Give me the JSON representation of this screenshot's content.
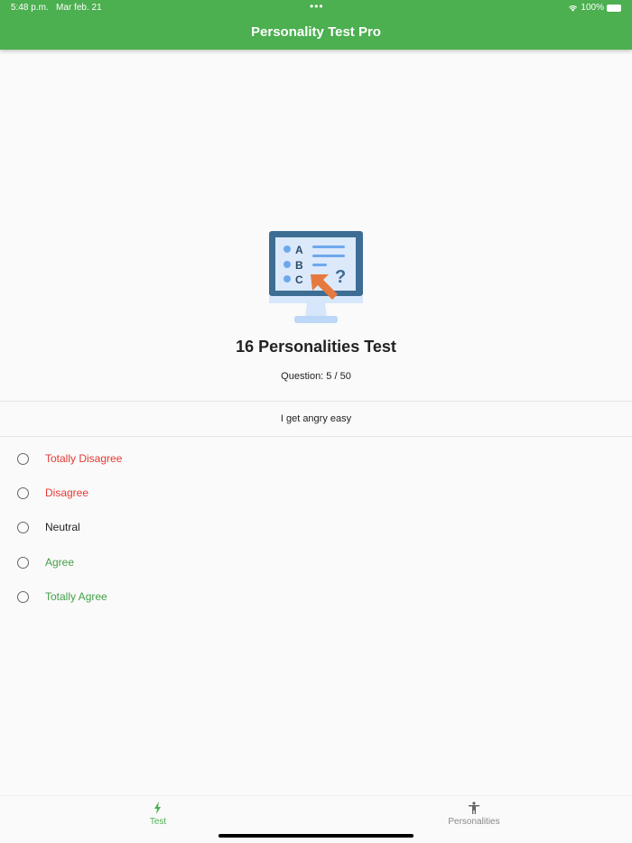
{
  "status": {
    "time": "5:48 p.m.",
    "date": "Mar feb. 21",
    "dots": "•••",
    "battery": "100%"
  },
  "app": {
    "title": "Personality Test Pro"
  },
  "illustration": {
    "letters": [
      "A",
      "B",
      "C"
    ],
    "mark": "?"
  },
  "test": {
    "heading": "16 Personalities Test",
    "question_counter": "Question: 5 / 50",
    "question": "I get angry easy"
  },
  "options": [
    {
      "label": "Totally Disagree",
      "color": "#e53935"
    },
    {
      "label": "Disagree",
      "color": "#e53935"
    },
    {
      "label": "Neutral",
      "color": "#222222"
    },
    {
      "label": "Agree",
      "color": "#43a047"
    },
    {
      "label": "Totally Agree",
      "color": "#43a047"
    }
  ],
  "tabs": [
    {
      "label": "Test",
      "icon": "bolt-icon",
      "active": true
    },
    {
      "label": "Personalities",
      "icon": "person-icon",
      "active": false
    }
  ],
  "colors": {
    "primary": "#4caf50",
    "inactive": "#888888"
  }
}
